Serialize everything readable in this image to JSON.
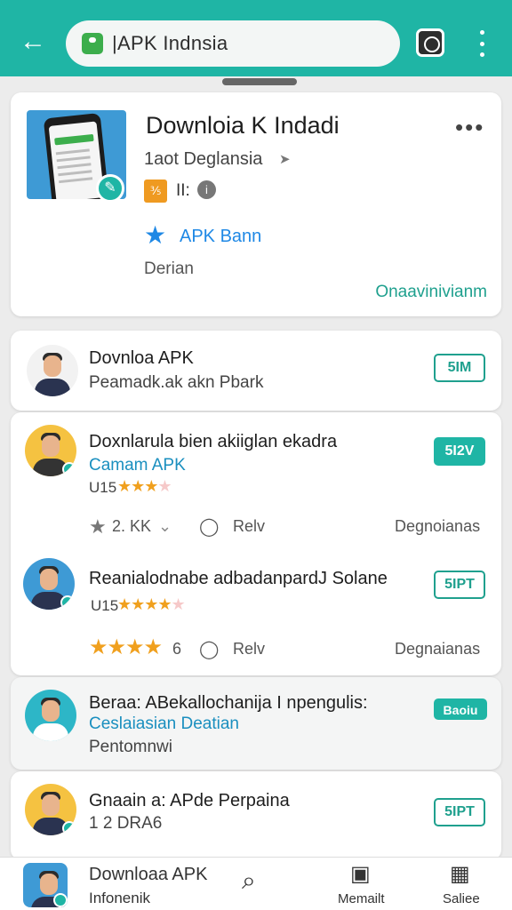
{
  "appbar": {
    "search_text": "|APK  Indnsia"
  },
  "hero": {
    "title": "Downloia K Indadi",
    "subtitle": "1aot Deglansia",
    "rated_badge": "⅗",
    "rated_text": "II:",
    "star_text": "APK  Bann",
    "description": "Derian",
    "link": "Onaavinivianm"
  },
  "items": [
    {
      "title": "Dovnloa APK",
      "subtitle": "Peamadk.ak akn Pbark",
      "button": "5IM"
    },
    {
      "title": "Doxnlarula bien akiiglan ekadra",
      "tag": "Camam APK",
      "rating_label": "U15",
      "button": "5I2V",
      "meta_count": "2.  KK",
      "meta_review": "Relv",
      "meta_right": "Degnoianas"
    },
    {
      "title": "Reanialodnabe adbadanpardJ Solane",
      "rating_label": "U15",
      "button": "5IPT",
      "meta_count": "6",
      "meta_review": "Relv",
      "meta_right": "Degnaianas"
    },
    {
      "title": "Beraa: ABekallochanija I npengulis:",
      "tag": "Ceslaiasian Deatian",
      "subtitle": "Pentomnwi",
      "button": "Baoiu"
    },
    {
      "title": "Gnaain    a: APde Perpaina",
      "subtitle": "1 2  DRA6",
      "button": "5IPT"
    }
  ],
  "bottom_nav": {
    "title": "Downloaa APK",
    "subtitle": "Infonenik",
    "item2_label": "Memailt",
    "item3_label": "Saliee"
  },
  "colors": {
    "accent": "#1fb5a5",
    "star": "#f0a01e",
    "link_blue": "#1a8fbf"
  },
  "icons": [
    "back-arrow-icon",
    "apk-bag-icon",
    "camera-icon",
    "more-vert-icon",
    "star-icon",
    "info-icon",
    "chat-icon",
    "search-refresh-icon",
    "camera-nav-icon",
    "tools-icon"
  ]
}
